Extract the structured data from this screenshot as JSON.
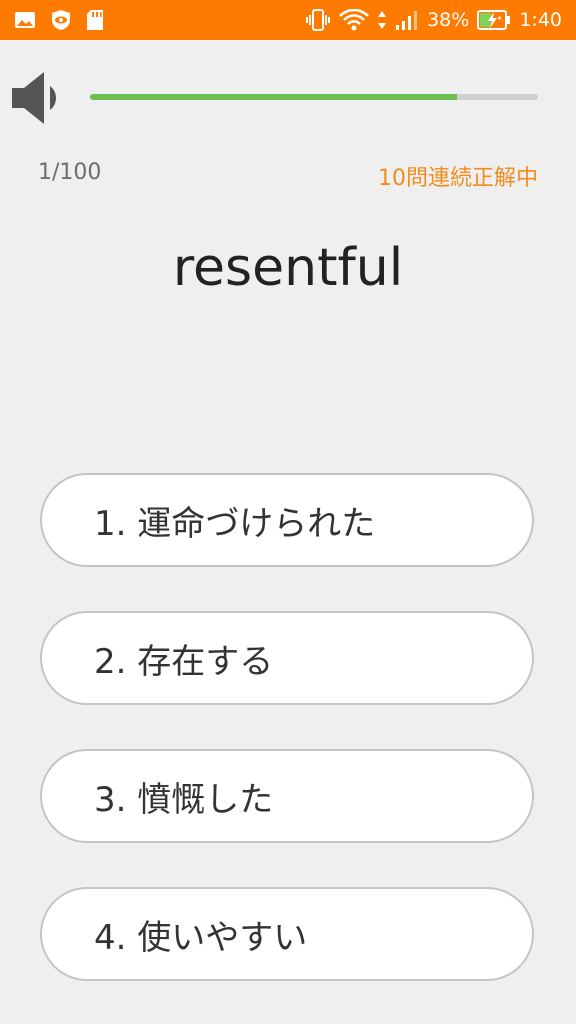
{
  "status_bar": {
    "battery_percent": "38%",
    "time": "1:40",
    "icons": [
      "image-icon",
      "shield-eye-icon",
      "sd-card-icon",
      "vibrate-icon",
      "wifi-icon",
      "signal-icon",
      "battery-charging-icon"
    ],
    "background": "#ff7a00"
  },
  "audio": {
    "icon": "speaker-icon",
    "progress": 0.82,
    "progress_color": "#6cbf4f"
  },
  "quiz": {
    "counter": "1/100",
    "streak": "10問連続正解中",
    "streak_color": "#f08c1e",
    "word": "resentful",
    "options": [
      {
        "label": "1. 運命づけられた"
      },
      {
        "label": "2. 存在する"
      },
      {
        "label": "3. 憤慨した"
      },
      {
        "label": "4. 使いやすい"
      }
    ]
  }
}
